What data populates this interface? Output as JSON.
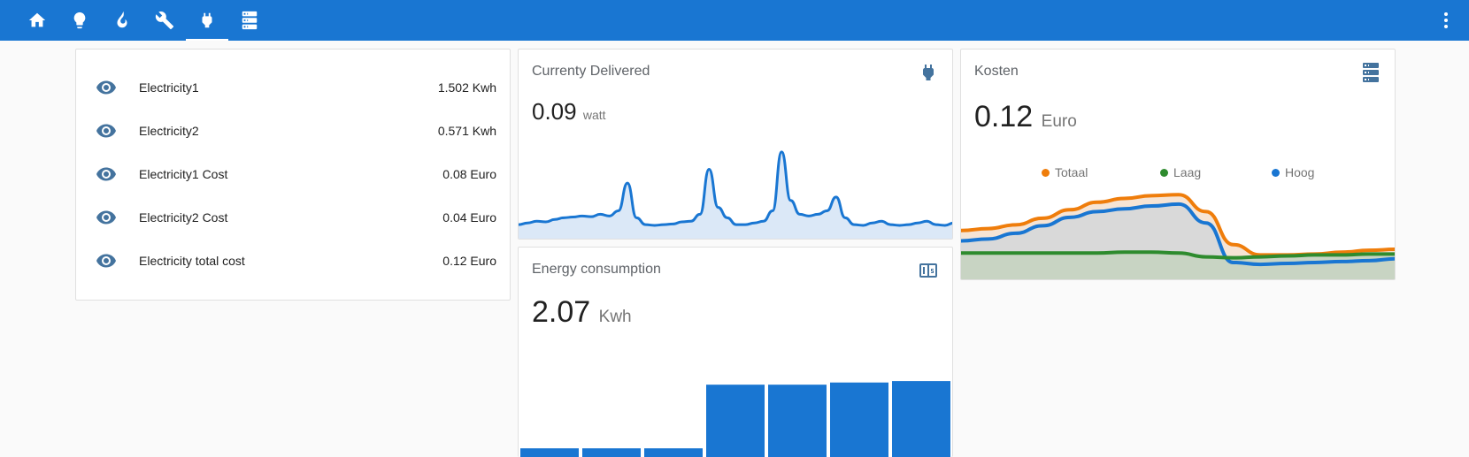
{
  "toolbar": {
    "tabs": [
      {
        "icon": "home-icon"
      },
      {
        "icon": "lightbulb-icon"
      },
      {
        "icon": "fire-icon"
      },
      {
        "icon": "wrench-icon"
      },
      {
        "icon": "power-plug-icon",
        "active": true
      },
      {
        "icon": "server-icon"
      }
    ],
    "menu_icon": "dots-vertical-icon",
    "color": "#1976d2"
  },
  "entities": [
    {
      "icon": "eye-icon",
      "name": "Electricity1",
      "value": "1.502 Kwh"
    },
    {
      "icon": "eye-icon",
      "name": "Electricity2",
      "value": "0.571 Kwh"
    },
    {
      "icon": "eye-icon",
      "name": "Electricity1 Cost",
      "value": "0.08 Euro"
    },
    {
      "icon": "eye-icon",
      "name": "Electricity2 Cost",
      "value": "0.04 Euro"
    },
    {
      "icon": "eye-icon",
      "name": "Electricity total cost",
      "value": "0.12 Euro"
    }
  ],
  "current": {
    "title": "Currenty Delivered",
    "value": "0.09",
    "unit": "watt",
    "icon": "power-plug-icon",
    "color": "#1976d2",
    "history": [
      0.02,
      0.025,
      0.03,
      0.028,
      0.035,
      0.04,
      0.042,
      0.045,
      0.043,
      0.05,
      0.045,
      0.06,
      0.14,
      0.04,
      0.02,
      0.018,
      0.02,
      0.022,
      0.028,
      0.03,
      0.05,
      0.18,
      0.07,
      0.04,
      0.02,
      0.02,
      0.025,
      0.03,
      0.06,
      0.23,
      0.09,
      0.05,
      0.045,
      0.05,
      0.06,
      0.1,
      0.04,
      0.02,
      0.018,
      0.025,
      0.03,
      0.02,
      0.018,
      0.02,
      0.025,
      0.03,
      0.02,
      0.018,
      0.025
    ]
  },
  "energy": {
    "title": "Energy consumption",
    "value": "2.07",
    "unit": "Kwh",
    "icon": "counter-icon",
    "color": "#1976d2",
    "bars": [
      0.12,
      0.12,
      0.12,
      1.0,
      1.0,
      1.03,
      1.05
    ]
  },
  "kosten": {
    "title": "Kosten",
    "value": "0.12",
    "unit": "Euro",
    "icon": "server-icon",
    "legend": [
      {
        "name": "Totaal",
        "color": "#ef7d0b"
      },
      {
        "name": "Laag",
        "color": "#2e8b2e"
      },
      {
        "name": "Hoog",
        "color": "#1976d2"
      }
    ],
    "series": {
      "Totaal": [
        0.09,
        0.092,
        0.096,
        0.103,
        0.112,
        0.12,
        0.124,
        0.127,
        0.128,
        0.11,
        0.075,
        0.064,
        0.064,
        0.065,
        0.067,
        0.069,
        0.07
      ],
      "Laag": [
        0.066,
        0.066,
        0.066,
        0.066,
        0.066,
        0.066,
        0.067,
        0.067,
        0.066,
        0.062,
        0.061,
        0.062,
        0.063,
        0.064,
        0.064,
        0.065,
        0.065
      ],
      "Hoog": [
        0.079,
        0.081,
        0.087,
        0.095,
        0.104,
        0.11,
        0.113,
        0.116,
        0.118,
        0.098,
        0.056,
        0.054,
        0.055,
        0.056,
        0.057,
        0.058,
        0.06
      ]
    }
  }
}
